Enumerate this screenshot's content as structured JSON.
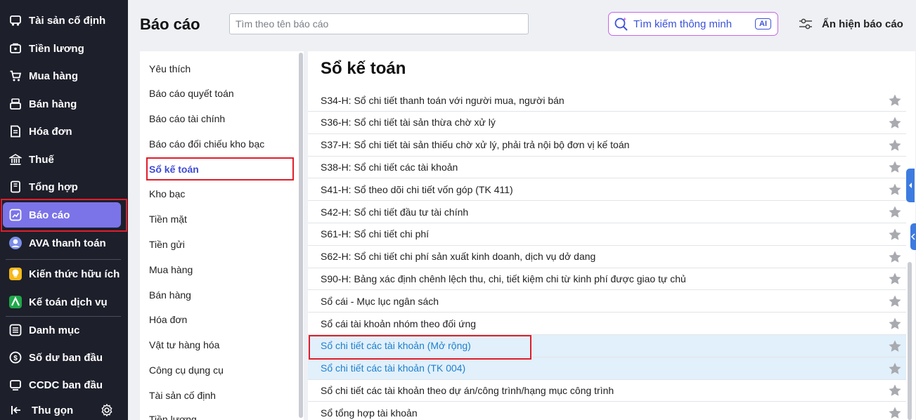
{
  "sidebar": {
    "items": [
      {
        "label": "Tài sản cố định",
        "icon": "car-icon"
      },
      {
        "label": "Tiền lương",
        "icon": "wallet-icon"
      },
      {
        "label": "Mua hàng",
        "icon": "cart-icon"
      },
      {
        "label": "Bán hàng",
        "icon": "cashier-icon"
      },
      {
        "label": "Hóa đơn",
        "icon": "invoice-icon"
      },
      {
        "label": "Thuế",
        "icon": "bank-icon"
      },
      {
        "label": "Tổng hợp",
        "icon": "book-icon"
      },
      {
        "label": "Báo cáo",
        "icon": "chart-icon",
        "active": true
      },
      {
        "label": "AVA thanh toán",
        "icon": "ava-avatar-icon"
      },
      {
        "label": "Kiến thức hữu ích",
        "icon": "lightbulb-icon"
      },
      {
        "label": "Kế toán dịch vụ",
        "icon": "service-logo-icon"
      },
      {
        "label": "Danh mục",
        "icon": "list-icon"
      },
      {
        "label": "Số dư ban đầu",
        "icon": "dollar-icon"
      },
      {
        "label": "CCDC ban đầu",
        "icon": "tools-icon"
      }
    ],
    "collapse_label": "Thu gọn"
  },
  "header": {
    "title": "Báo cáo",
    "search_placeholder": "Tìm theo tên báo cáo",
    "smart_search_label": "Tìm kiếm thông minh",
    "ai_badge": "AI",
    "toggle_reports_label": "Ẩn hiện báo cáo"
  },
  "categories": {
    "items": [
      "Yêu thích",
      "Báo cáo quyết toán",
      "Báo cáo tài chính",
      "Báo cáo đối chiếu kho bạc",
      "Sổ kế toán",
      "Kho bạc",
      "Tiền mặt",
      "Tiền gửi",
      "Mua hàng",
      "Bán hàng",
      "Hóa đơn",
      "Vật tư hàng hóa",
      "Công cụ dụng cụ",
      "Tài sản cố định",
      "Tiền lương"
    ],
    "active_index": 4
  },
  "reports": {
    "title": "Sổ kế toán",
    "rows": [
      "S34-H: Sổ chi tiết thanh toán với người mua, người bán",
      "S36-H: Sổ chi tiết tài sản thừa chờ xử lý",
      "S37-H: Sổ chi tiết tài sản thiếu chờ xử lý, phải trả nội bộ đơn vị kế toán",
      "S38-H: Sổ chi tiết các tài khoản",
      "S41-H: Sổ theo dõi chi tiết vốn góp (TK 411)",
      "S42-H: Sổ chi tiết đầu tư tài chính",
      "S61-H: Sổ chi tiết chi phí",
      "S62-H: Sổ chi tiết chi phí sản xuất kinh doanh, dịch vụ dở dang",
      "S90-H: Bảng xác định chênh lệch thu, chi, tiết kiệm chi từ kinh phí được giao tự chủ",
      "Sổ cái - Mục lục ngân sách",
      "Sổ cái tài khoản nhóm theo đối ứng",
      "Sổ chi tiết các tài khoản (Mở rộng)",
      "Sổ chi tiết các tài khoản (TK 004)",
      "Sổ chi tiết các tài khoản theo dự án/công trình/hạng mục công trình",
      "Sổ tổng hợp tài khoản"
    ],
    "highlighted_indices": [
      11,
      12
    ]
  },
  "colors": {
    "sidebar_bg": "#1d1f2b",
    "active_accent": "#7b73e8",
    "highlight_box": "#e11d2b",
    "link_blue": "#1e7fcf",
    "category_active": "#3f4bd6"
  }
}
